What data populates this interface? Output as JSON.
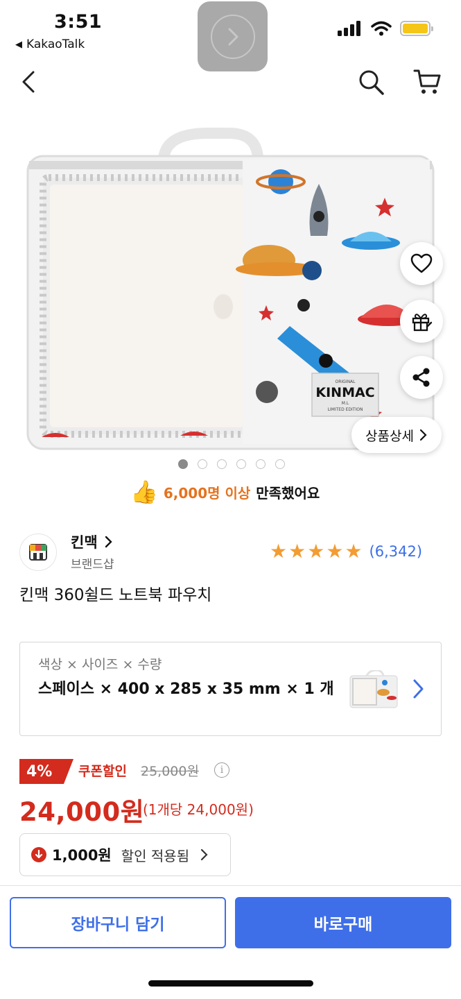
{
  "status_bar": {
    "time": "3:51",
    "back_app": "KakaoTalk",
    "battery_color": "#f5c518"
  },
  "nav": {
    "icons": [
      "back-chevron-icon",
      "search-icon",
      "cart-icon"
    ]
  },
  "product_image": {
    "brand_tag": "KINMAC",
    "brand_tag_sub": "ORIGINAL",
    "brand_tag_size": "M.L",
    "brand_tag_edition": "LIMITED EDITION",
    "detail_button": "상품상세",
    "carousel_total": 6,
    "carousel_active_index": 0
  },
  "satisfaction": {
    "highlight": "6,000명 이상",
    "rest": "만족했어요"
  },
  "brand": {
    "name": "킨맥",
    "sub": "브랜드샵",
    "rating_stars": 5,
    "review_count": "(6,342)"
  },
  "product": {
    "title": "킨맥 360쉴드 노트북 파우치"
  },
  "option": {
    "label": "색상 × 사이즈 × 수량",
    "value": "스페이스 × 400 x 285 x 35 mm × 1 개"
  },
  "price": {
    "discount_rate": "4%",
    "coupon_label": "쿠폰할인",
    "original": "25,000원",
    "sale": "24,000원",
    "unit": "(1개당 24,000원)",
    "coupon_amount": "1,000원",
    "coupon_text": "할인 적용됨"
  },
  "actions": {
    "cart": "장바구니 담기",
    "buy": "바로구매"
  },
  "colors": {
    "accent_blue": "#3f6fe8",
    "sale_red": "#d32b1d",
    "star_orange": "#f39c33"
  }
}
